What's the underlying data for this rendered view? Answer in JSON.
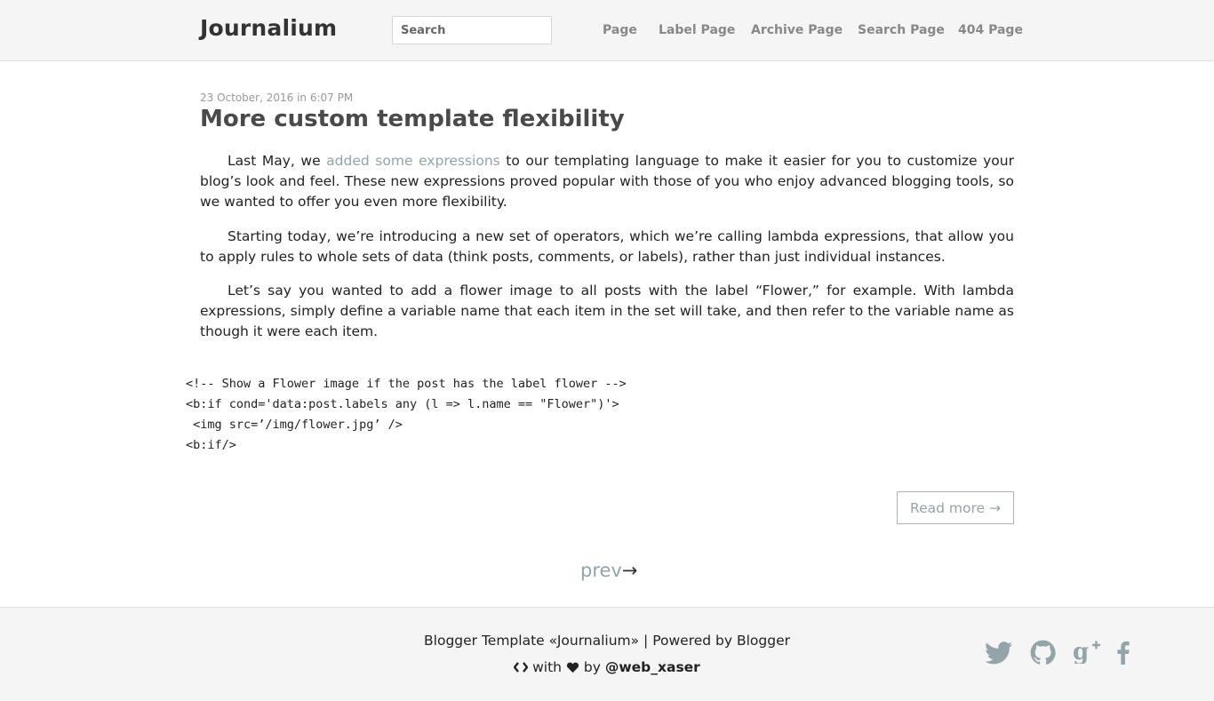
{
  "header": {
    "brand": "Journalium",
    "search_placeholder": "Search",
    "nav": [
      "Page",
      "Label Page",
      "Archive Page",
      "Search Page",
      "404 Page"
    ]
  },
  "post": {
    "meta": "23 October, 2016 in 6:07 PM",
    "title": "More custom template flexibility",
    "p1_before": "Last May, we ",
    "p1_link": "added some expressions",
    "p1_after": " to our templating language to make it easier for you to customize your blog’s look and feel. These new expressions proved popular with those of you who enjoy advanced blogging tools, so we wanted to offer you even more flexibility.",
    "p2": "Starting today, we’re introducing a new set of operators, which we’re calling lambda expressions, that allow you to apply rules to whole sets of data (think posts, comments, or labels), rather than just individual instances.",
    "p3": "Let’s say you wanted to add a flower image to all posts with the label “Flower,” for example. With lambda expressions, simply define a variable name that each item in the set will take, and then refer to the variable name as though it were each item.",
    "code": [
      "<!-- Show a Flower image if the post has the label flower -->",
      "<b:if cond='data:post.labels any (l => l.name == \"Flower\")'>",
      " <img src=’/img/flower.jpg’ />",
      "<b:if/>"
    ],
    "read_more": "Read more →"
  },
  "pager": {
    "label": "prev",
    "arrow": "→"
  },
  "footer": {
    "line1": "Blogger Template «Journalium» | Powered by Blogger",
    "with": "with",
    "by": "by",
    "handle": "@web_xaser",
    "icons": [
      "code-icon",
      "heart-icon",
      "twitter-icon",
      "github-icon",
      "google-plus-icon",
      "facebook-icon"
    ]
  },
  "colors": {
    "accent": "#93a4ab",
    "header_bg": "#f5f5f5",
    "title": "#4a4a4a"
  }
}
